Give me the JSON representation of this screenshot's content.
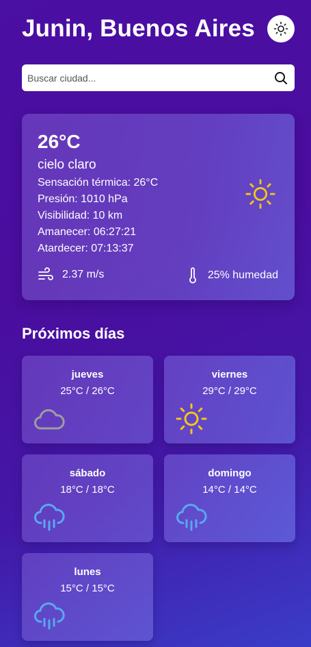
{
  "header": {
    "city": "Junin, Buenos Aires",
    "theme_toggle_icon": "sun-icon"
  },
  "search": {
    "placeholder": "Buscar ciudad...",
    "value": "",
    "icon": "search-icon"
  },
  "current": {
    "temperature": "26°C",
    "description": "cielo claro",
    "feels_like": "Sensación térmica: 26°C",
    "pressure": "Presión: 1010 hPa",
    "visibility": "Visibilidad: 10 km",
    "sunrise": "Amanecer: 06:27:21",
    "sunset": "Atardecer: 07:13:37",
    "icon": "sun-icon",
    "wind": "2.37 m/s",
    "humidity": "25% humedad"
  },
  "forecast": {
    "title": "Próximos días",
    "days": [
      {
        "name": "jueves",
        "temps": "25°C / 26°C",
        "icon": "cloud-icon"
      },
      {
        "name": "viernes",
        "temps": "29°C / 29°C",
        "icon": "sun-icon"
      },
      {
        "name": "sábado",
        "temps": "18°C / 18°C",
        "icon": "rain-icon"
      },
      {
        "name": "domingo",
        "temps": "14°C / 14°C",
        "icon": "rain-icon"
      },
      {
        "name": "lunes",
        "temps": "15°C / 15°C",
        "icon": "rain-icon"
      }
    ]
  },
  "colors": {
    "sun": "#f5c518",
    "rain": "#5aa8f0",
    "cloud": "#9e9e9e"
  }
}
